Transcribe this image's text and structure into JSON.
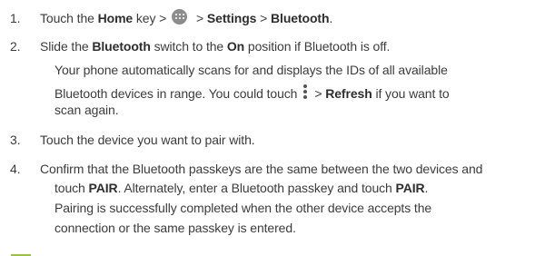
{
  "colors": {
    "text": "#3c3c3c",
    "bold_text": "#2e2e2e",
    "accent": "#9bc23c",
    "icon_gray": "#8c8c8c"
  },
  "icons": {
    "apps": "apps-grid-icon",
    "menu": "overflow-menu-icon"
  },
  "steps": [
    {
      "number": "1.",
      "parts": {
        "a": "Touch the ",
        "b": "Home",
        "c": " key >",
        "d": " > ",
        "e": "Settings",
        "f": " > ",
        "g": "Bluetooth",
        "h": "."
      }
    },
    {
      "number": "2.",
      "parts": {
        "a": "Slide the ",
        "b": "Bluetooth",
        "c": " switch to the ",
        "d": "On",
        "e": " position if Bluetooth is off."
      },
      "note_lines": {
        "line1": "Your phone automatically scans for and displays the IDs of all available",
        "line2_a": "Bluetooth devices in range. You could touch",
        "line2_b": "> ",
        "line2_c": "Refresh",
        "line2_d": " if you want to",
        "line3": "scan again."
      }
    },
    {
      "number": "3.",
      "parts": {
        "a": "Touch the device you want to pair with."
      }
    },
    {
      "number": "4.",
      "parts": {
        "a": "Confirm that the Bluetooth passkeys are the same between the two devices and",
        "b": "touch ",
        "c": "PAIR",
        "d": ". Alternately, enter a Bluetooth passkey and touch ",
        "e": "PAIR",
        "f": "."
      },
      "note_lines": {
        "line1": "Pairing is successfully completed when the other device accepts the",
        "line2": "connection or the same passkey is entered."
      }
    }
  ]
}
